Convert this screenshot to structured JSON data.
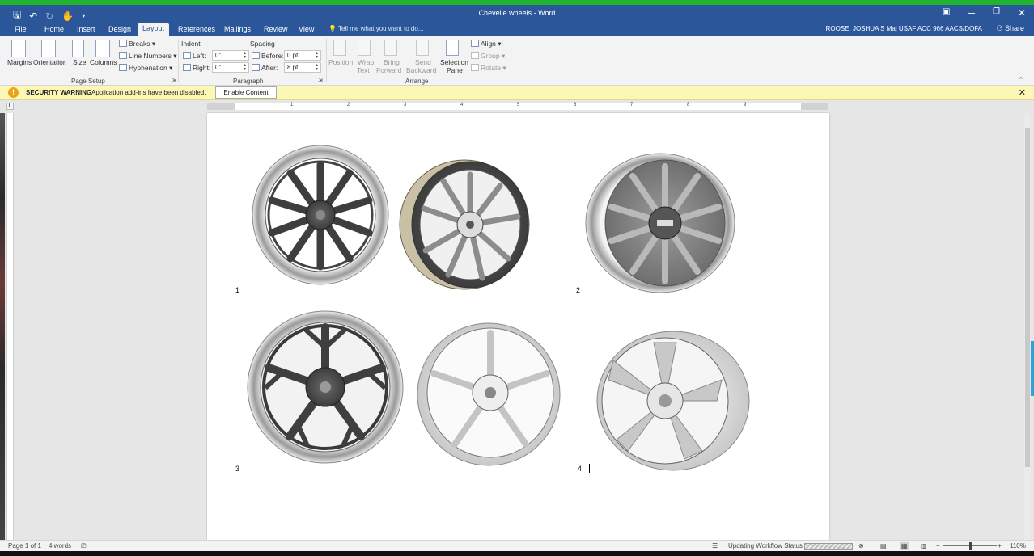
{
  "title_bar": {
    "title": "Chevelle wheels - Word",
    "controls": [
      "restore-ribbon",
      "minimize",
      "maximize",
      "close"
    ]
  },
  "tabs": [
    {
      "label": "File"
    },
    {
      "label": "Home"
    },
    {
      "label": "Insert"
    },
    {
      "label": "Design"
    },
    {
      "label": "Layout",
      "active": true
    },
    {
      "label": "References"
    },
    {
      "label": "Mailings"
    },
    {
      "label": "Review"
    },
    {
      "label": "View"
    }
  ],
  "tell_me": "Tell me what you want to do...",
  "user": "ROOSE, JOSHUA S Maj USAF ACC 966 AACS/DOFA",
  "share": "Share",
  "ribbon": {
    "page_setup": {
      "label": "Page Setup",
      "margins": "Margins",
      "orientation": "Orientation",
      "size": "Size",
      "columns": "Columns",
      "breaks": "Breaks",
      "line_numbers": "Line Numbers",
      "hyphenation": "Hyphenation"
    },
    "paragraph": {
      "label": "Paragraph",
      "indent": "Indent",
      "spacing": "Spacing",
      "left_label": "Left:",
      "left_value": "0\"",
      "right_label": "Right:",
      "right_value": "0\"",
      "before_label": "Before:",
      "before_value": "0 pt",
      "after_label": "After:",
      "after_value": "8 pt"
    },
    "arrange": {
      "label": "Arrange",
      "position": "Position",
      "wrap_text_1": "Wrap",
      "wrap_text_2": "Text",
      "bring_forward_1": "Bring",
      "bring_forward_2": "Forward",
      "send_backward_1": "Send",
      "send_backward_2": "Backward",
      "selection_pane_1": "Selection",
      "selection_pane_2": "Pane",
      "align": "Align",
      "group": "Group",
      "rotate": "Rotate"
    }
  },
  "security": {
    "title": "SECURITY WARNING",
    "message": "Application add-ins have been disabled.",
    "button": "Enable Content"
  },
  "ruler_numbers": [
    "1",
    "2",
    "3",
    "4",
    "5",
    "6",
    "7",
    "8",
    "9"
  ],
  "document": {
    "captions": [
      "1",
      "2",
      "3",
      "4"
    ]
  },
  "status": {
    "page": "Page 1 of 1",
    "words": "4 words",
    "workflow": "Updating Workflow Status",
    "zoom": "110%"
  }
}
